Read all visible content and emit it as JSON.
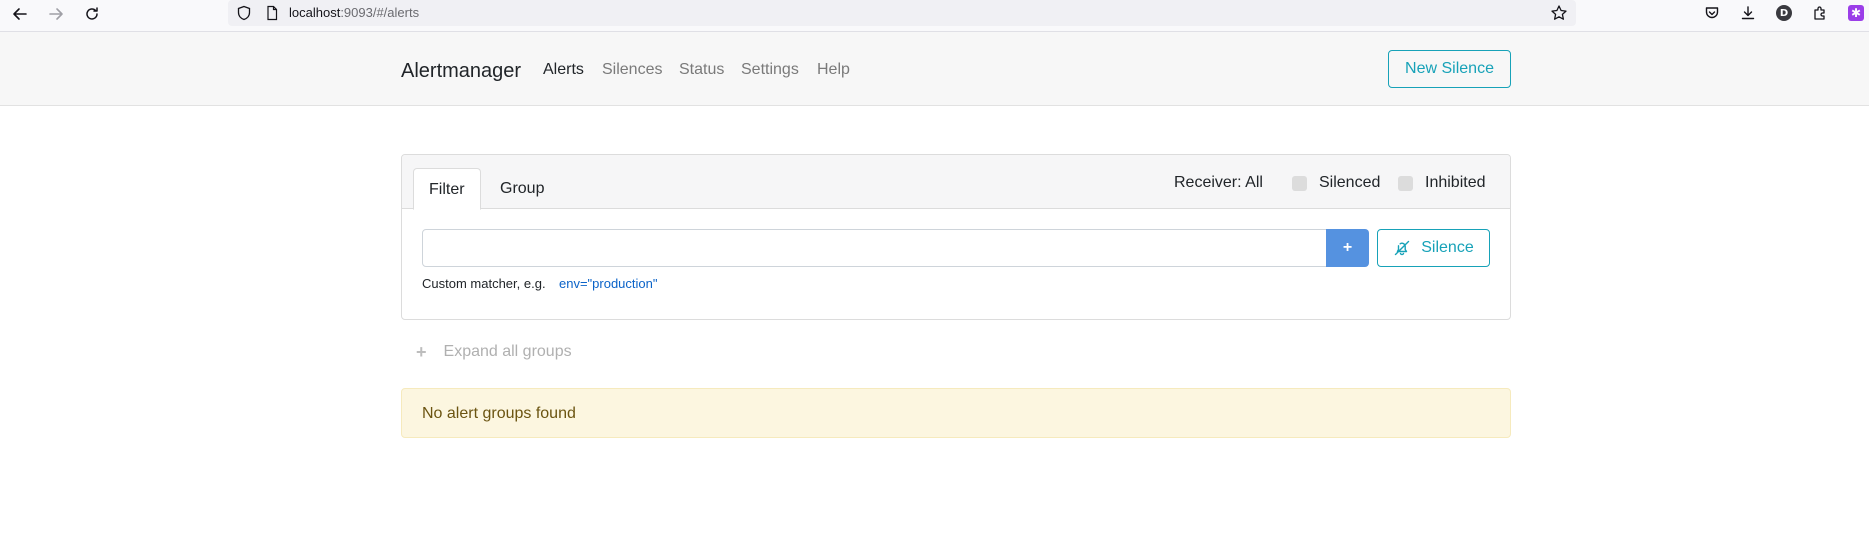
{
  "browser": {
    "url_host": "localhost",
    "url_rest": ":9093/#/alerts"
  },
  "app": {
    "brand": "Alertmanager",
    "nav": [
      {
        "label": "Alerts",
        "active": true
      },
      {
        "label": "Silences",
        "active": false
      },
      {
        "label": "Status",
        "active": false
      },
      {
        "label": "Settings",
        "active": false
      },
      {
        "label": "Help",
        "active": false
      }
    ],
    "new_silence_label": "New Silence"
  },
  "filter_panel": {
    "tabs": [
      {
        "label": "Filter",
        "active": true
      },
      {
        "label": "Group",
        "active": false
      }
    ],
    "receiver_label": "Receiver: All",
    "silenced_label": "Silenced",
    "inhibited_label": "Inhibited",
    "input_value": "",
    "add_label": "+",
    "silence_button_label": "Silence",
    "hint_text": "Custom matcher, e.g.",
    "hint_example": "env=\"production\""
  },
  "expand_label": "Expand all groups",
  "expand_icon": "+",
  "alert_message": "No alert groups found",
  "icons": {
    "back": "arrow-left-icon",
    "forward": "arrow-right-icon",
    "reload": "reload-icon",
    "shield": "shield-icon",
    "page": "page-icon",
    "bookmark": "star-icon",
    "pocket": "pocket-icon",
    "downloads": "download-icon",
    "profile": "profile-avatar",
    "extensions": "extensions-icon",
    "extension": "purple-extension-icon",
    "silence": "bell-slash-icon"
  },
  "avatar_letter": "D",
  "colors": {
    "accent": "#17a2b8",
    "plus_button": "#5592e0",
    "warning_bg": "#fcf6e0",
    "warning_text": "#6b5411",
    "link": "#0b63c8"
  }
}
